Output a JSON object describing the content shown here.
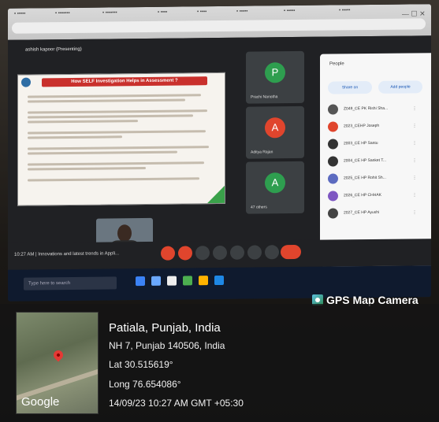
{
  "gps_stamp": {
    "app_label": "GPS Map Camera",
    "city": "Patiala, Punjab, India",
    "address": "NH 7, Punjab 140506, India",
    "lat": "Lat 30.515619°",
    "long": "Long 76.654086°",
    "datetime": "14/09/23 10:27 AM GMT +05:30",
    "map_brand": "Google"
  },
  "meet": {
    "presenter": "ashish kapoor (Presenting)",
    "slide_title": "How SELF Investigation Helps in Assessment ?",
    "meeting_name": "Innovations and latest trends in Appli...",
    "time": "10:27 AM",
    "tiles": [
      {
        "initial": "P",
        "name": "Prachi Nanotha",
        "color": "#2e9e4f"
      },
      {
        "initial": "A",
        "name": "Aditya Rajan",
        "color": "#e0452d"
      },
      {
        "initial": "A",
        "name": "47 others",
        "color": "#2e9e4f"
      }
    ]
  },
  "people_panel": {
    "title": "People",
    "buttons": [
      "Share on",
      "Add people"
    ],
    "rows": [
      "Z049_CE PK Rishi Sha...",
      "2023_CEHP Joseph",
      "2003_CE HP Santu",
      "2004_CE HP Sanket T...",
      "2025_CE HP Rohit Sh...",
      "2026_CE HP CHHAK",
      "2027_CE HP Ayushi"
    ]
  },
  "taskbar": {
    "search_placeholder": "Type here to search"
  }
}
